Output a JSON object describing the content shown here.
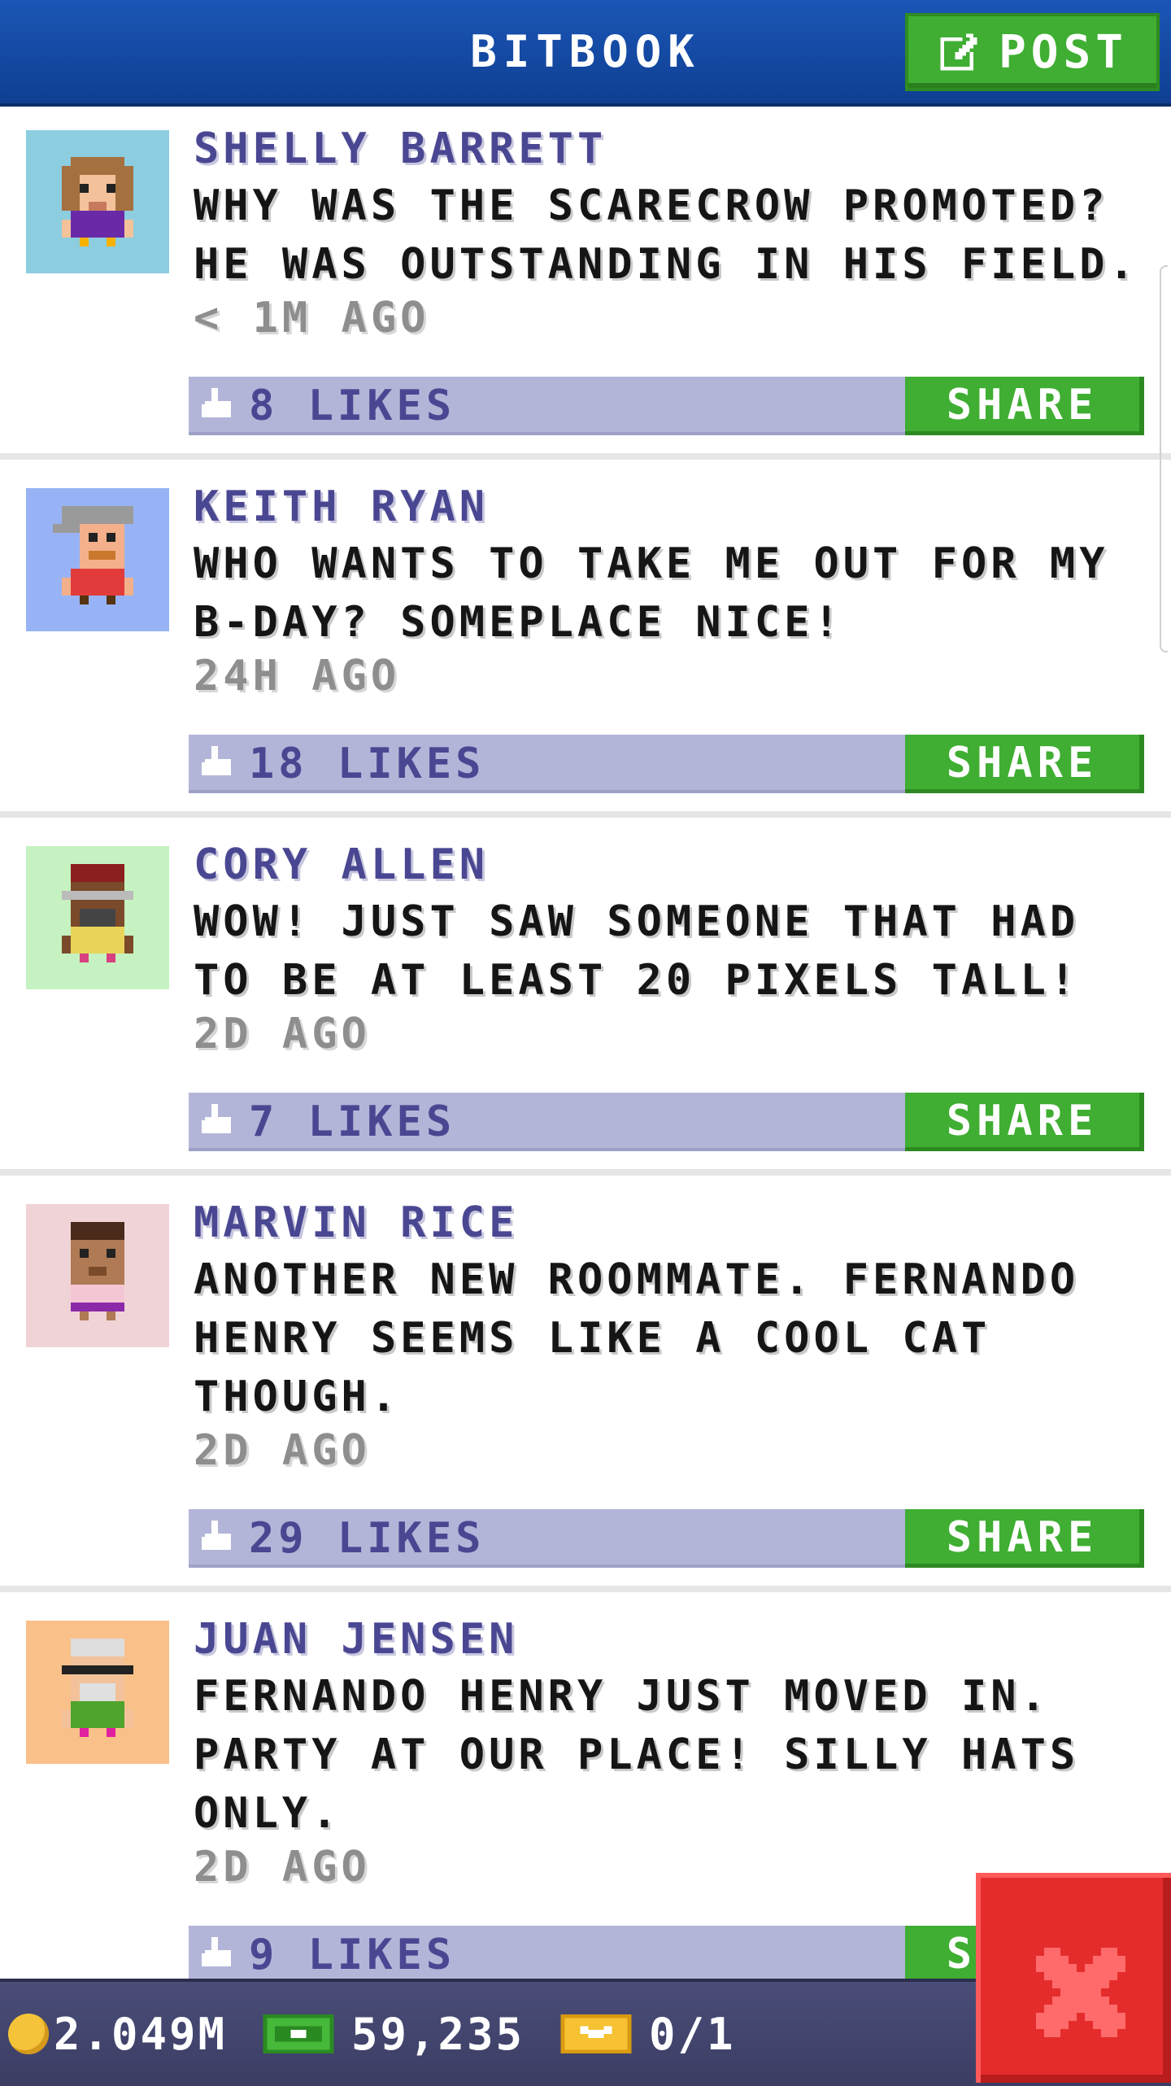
{
  "header": {
    "title": "BITBOOK",
    "post_label": "POST",
    "post_icon": "edit-icon"
  },
  "posts": [
    {
      "author": "SHELLY BARRETT",
      "message": "WHY WAS THE SCARECROW PROMOTED? HE WAS OUTSTANDING IN HIS FIELD.",
      "time": "< 1M AGO",
      "likes": "8 LIKES",
      "share_label": "SHARE",
      "avatar_bg": "#8ccde0"
    },
    {
      "author": "KEITH RYAN",
      "message": "WHO WANTS TO TAKE ME OUT FOR MY B-DAY? SOMEPLACE NICE!",
      "time": "24H AGO",
      "likes": "18 LIKES",
      "share_label": "SHARE",
      "avatar_bg": "#98b3f5"
    },
    {
      "author": "CORY ALLEN",
      "message": "WOW! JUST SAW SOMEONE THAT HAD TO BE AT LEAST 20 PIXELS TALL!",
      "time": "2D AGO",
      "likes": "7 LIKES",
      "share_label": "SHARE",
      "avatar_bg": "#c5f2c0"
    },
    {
      "author": "MARVIN RICE",
      "message": "ANOTHER NEW ROOMMATE. FERNANDO HENRY SEEMS LIKE A COOL CAT THOUGH.",
      "time": "2D AGO",
      "likes": "29 LIKES",
      "share_label": "SHARE",
      "avatar_bg": "#f0d3d6"
    },
    {
      "author": "JUAN JENSEN",
      "message": "FERNANDO HENRY JUST MOVED IN. PARTY AT OUR PLACE! SILLY HATS ONLY.",
      "time": "2D AGO",
      "likes": "9 LIKES",
      "share_label": "SHARE",
      "avatar_bg": "#f9c08a"
    }
  ],
  "status": {
    "coins": "2.049M",
    "bux": "59,235",
    "tickets": "0/1"
  },
  "colors": {
    "header_blue": "#1b56b6",
    "share_green": "#3fae32",
    "likes_bar": "#b3b5d8",
    "name_purple": "#4a4792",
    "close_red": "#e52c2c"
  }
}
